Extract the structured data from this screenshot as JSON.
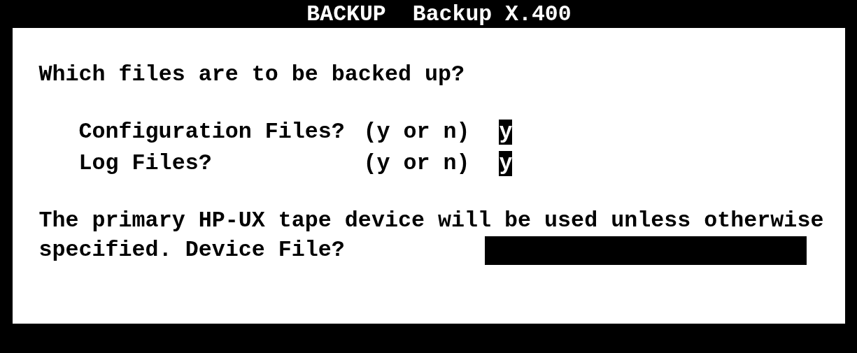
{
  "title": {
    "command": "BACKUP",
    "name": "Backup X.400"
  },
  "prompt": "Which files are to be backed up?",
  "questions": [
    {
      "label": "Configuration Files?",
      "hint": "(y or n)",
      "value": "y"
    },
    {
      "label": "Log Files?",
      "hint": "(y or n)",
      "value": "y"
    }
  ],
  "device": {
    "lines": [
      "The primary HP-UX tape device will be used unless otherwise",
      "specified. Device File?"
    ]
  }
}
